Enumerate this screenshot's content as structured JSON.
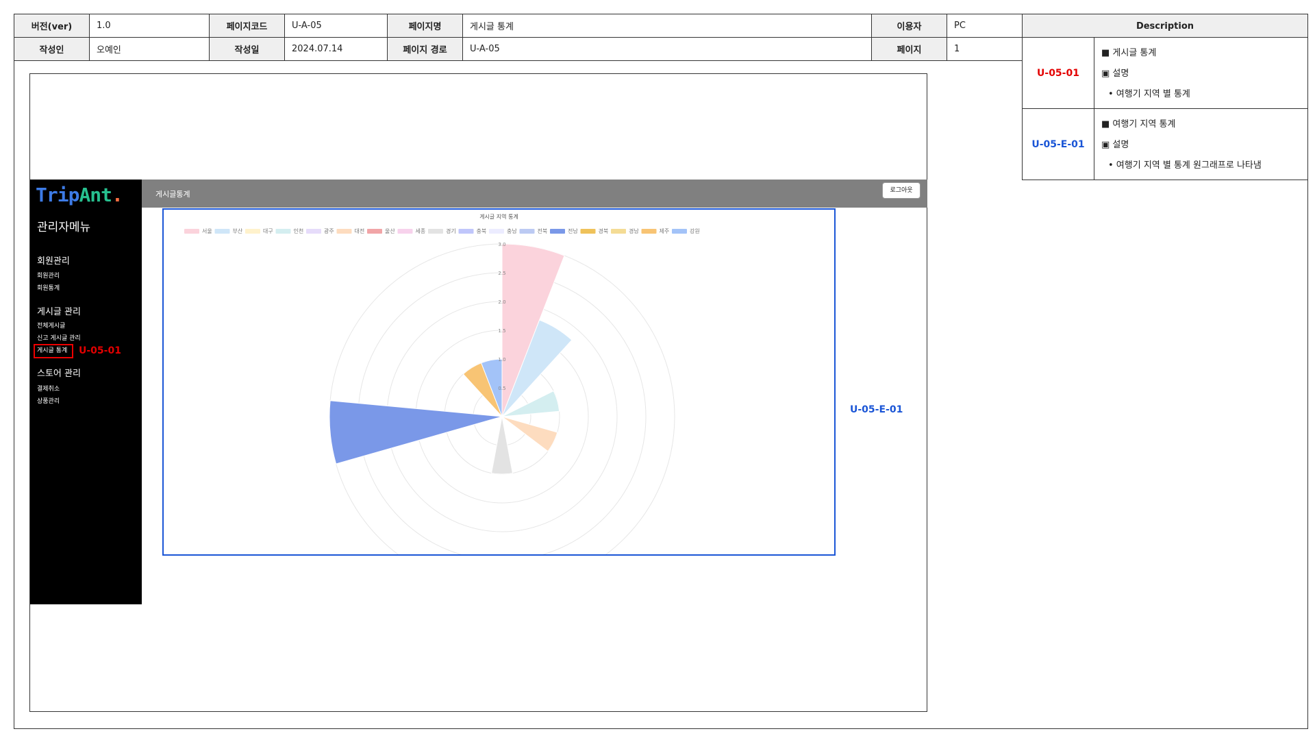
{
  "header": {
    "row1": [
      {
        "key": "버전(ver)",
        "value": "1.0"
      },
      {
        "key": "페이지코드",
        "value": "U-A-05"
      },
      {
        "key": "페이지명",
        "value": "게시글 통계"
      },
      {
        "key": "이용자",
        "value": "PC"
      }
    ],
    "row2": [
      {
        "key": "작성인",
        "value": "오예인"
      },
      {
        "key": "작성일",
        "value": "2024.07.14"
      },
      {
        "key": "페이지 경로",
        "value": "U-A-05"
      },
      {
        "key": "페이지",
        "value": "1"
      }
    ]
  },
  "description": {
    "title": "Description",
    "items": [
      {
        "id": "U-05-01",
        "line1": "■ 게시글 통계",
        "line2": "▣ 설명",
        "bullet": "• 여행기 지역 별 통계"
      },
      {
        "id": "U-05-E-01",
        "line1": "■ 여행기 지역 통계",
        "line2": "▣ 설명",
        "bullet": "• 여행기 지역 별 통계 원그래프로 나타냄"
      }
    ]
  },
  "sidebar": {
    "logo_a": "Trip",
    "logo_b": "Ant",
    "logo_dot": ".",
    "menu_title": "관리자메뉴",
    "sections": [
      {
        "label": "회원관리",
        "items": [
          "회원관리",
          "회원통계"
        ]
      },
      {
        "label": "게시글 관리",
        "items": [
          "전체게시글",
          "신고 게시글 관리",
          "게시글 통계"
        ]
      },
      {
        "label": "스토어 관리",
        "items": [
          "결제취소",
          "상품관리"
        ]
      }
    ]
  },
  "topbar": {
    "title": "게시글통계",
    "logout": "로그아웃"
  },
  "labels": {
    "selected": "U-05-01",
    "chart": "U-05-E-01"
  },
  "chart_data": {
    "type": "polarArea",
    "title": "게시글 지역 통계",
    "categories": [
      "서울",
      "부산",
      "대구",
      "인천",
      "광주",
      "대전",
      "울산",
      "세종",
      "경기",
      "충북",
      "충남",
      "전북",
      "전남",
      "경북",
      "경남",
      "제주",
      "강원"
    ],
    "values": [
      3.0,
      1.8,
      0,
      1.0,
      0,
      1.0,
      0,
      0,
      1.0,
      0,
      0,
      0,
      3.0,
      0,
      0,
      1.0,
      1.0
    ],
    "rlim": [
      0,
      3
    ],
    "ticks": [
      "0.5",
      "1.0",
      "1.5",
      "2.0",
      "2.5",
      "3.0"
    ],
    "colors": [
      "#fbd3dc",
      "#cfe6f8",
      "#fff2cc",
      "#d4eef0",
      "#e6dcfa",
      "#fddcbf",
      "#f1a5a7",
      "#f7d2ec",
      "#e3e3e3",
      "#c0c6fb",
      "#ececff",
      "#bccaf3",
      "#7a98e8",
      "#efc25a",
      "#f4dc95",
      "#f8c474",
      "#a3c3f8"
    ]
  }
}
